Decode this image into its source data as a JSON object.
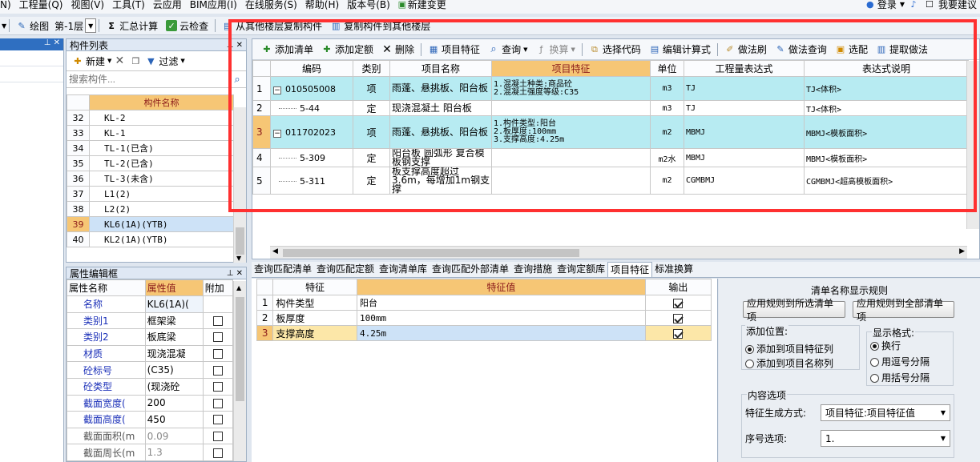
{
  "menubar": {
    "items": [
      "N)",
      "工程量(Q)",
      "视图(V)",
      "工具(T)",
      "云应用",
      "BIM应用(I)",
      "在线服务(S)",
      "帮助(H)",
      "版本号(B)",
      "新建变更"
    ],
    "login": "登录",
    "suggest": "我要建议"
  },
  "toolbar2": {
    "draw": "绘图",
    "floor": "第-1层",
    "sum": "汇总计算",
    "check": "云检查",
    "copy_from": "从其他楼层复制构件",
    "copy_to": "复制构件到其他楼层"
  },
  "component_list": {
    "title": "构件列表",
    "new_label": "新建",
    "filter_label": "过滤",
    "search_placeholder": "搜索构件...",
    "col_header": "构件名称",
    "rows": [
      {
        "n": "32",
        "name": "KL-2"
      },
      {
        "n": "33",
        "name": "KL-1"
      },
      {
        "n": "34",
        "name": "TL-1(已含)"
      },
      {
        "n": "35",
        "name": "TL-2(已含)"
      },
      {
        "n": "36",
        "name": "TL-3(未含)"
      },
      {
        "n": "37",
        "name": "L1(2)"
      },
      {
        "n": "38",
        "name": "L2(2)"
      },
      {
        "n": "39",
        "name": "KL6(1A)(YTB)"
      },
      {
        "n": "40",
        "name": "KL2(1A)(YTB)"
      }
    ],
    "selected_row": "39"
  },
  "property_editor": {
    "title": "属性编辑框",
    "cols": [
      "属性名称",
      "属性值",
      "附加"
    ],
    "rows": [
      {
        "name": "名称",
        "value": "KL6(1A)(",
        "extra": false
      },
      {
        "name": "类别1",
        "value": "框架梁",
        "extra": true
      },
      {
        "name": "类别2",
        "value": "板底梁",
        "extra": true
      },
      {
        "name": "材质",
        "value": "现浇混凝",
        "extra": true
      },
      {
        "name": "砼标号",
        "value": "(C35)",
        "extra": true
      },
      {
        "name": "砼类型",
        "value": "(现浇砼",
        "extra": true
      },
      {
        "name": "截面宽度(",
        "value": "200",
        "extra": true
      },
      {
        "name": "截面高度(",
        "value": "450",
        "extra": true
      },
      {
        "name": "截面面积(m",
        "value": "0.09",
        "extra": true
      },
      {
        "name": "截面周长(m",
        "value": "1.3",
        "extra": true
      }
    ]
  },
  "list_toolbar": {
    "add_list": "添加清单",
    "add_quota": "添加定额",
    "delete": "删除",
    "item_feature": "项目特征",
    "query": "查询",
    "convert": "换算",
    "select_code": "选择代码",
    "edit_formula": "编辑计算式",
    "method_brush": "做法刷",
    "method_query": "做法查询",
    "pick": "选配",
    "extract": "提取做法"
  },
  "bill_table": {
    "cols": [
      "编码",
      "类别",
      "项目名称",
      "项目特征",
      "单位",
      "工程量表达式",
      "表达式说明"
    ],
    "rows": [
      {
        "n": "1",
        "code": "010505008",
        "type": "项",
        "name": "雨蓬、悬挑板、阳台板",
        "feature": [
          "1.混凝土种类:商品砼",
          "2.混凝土强度等级:C35"
        ],
        "unit": "m3",
        "expr": "TJ",
        "desc": "TJ<体积>",
        "level": "parent"
      },
      {
        "n": "2",
        "code": "5-44",
        "type": "定",
        "name": "现浇混凝土 阳台板",
        "feature": [],
        "unit": "m3",
        "expr": "TJ",
        "desc": "TJ<体积>",
        "level": "child"
      },
      {
        "n": "3",
        "code": "011702023",
        "type": "项",
        "name": "雨蓬、悬挑板、阳台板",
        "feature": [
          "1.构件类型:阳台",
          "2.板厚度:100mm",
          "3.支撑高度:4.25m"
        ],
        "unit": "m2",
        "expr": "MBMJ",
        "desc": "MBMJ<模板面积>",
        "level": "parent"
      },
      {
        "n": "4",
        "code": "5-309",
        "type": "定",
        "name": "阳台板 圆弧形 复合模板钢支撑",
        "feature": [],
        "unit": "m2水",
        "expr": "MBMJ",
        "desc": "MBMJ<模板面积>",
        "level": "child"
      },
      {
        "n": "5",
        "code": "5-311",
        "type": "定",
        "name": "板支撑高度超过3.6m，每增加1m钢支撑",
        "feature": [],
        "unit": "m2",
        "expr": "CGMBMJ",
        "desc": "CGMBMJ<超高模板面积>",
        "level": "child"
      }
    ]
  },
  "bottom_tabs": [
    "查询匹配清单",
    "查询匹配定额",
    "查询清单库",
    "查询匹配外部清单",
    "查询措施",
    "查询定额库",
    "项目特征",
    "标准换算"
  ],
  "active_tab": "项目特征",
  "feature_table": {
    "cols": [
      "特征",
      "特征值",
      "输出"
    ],
    "rows": [
      {
        "n": "1",
        "feature": "构件类型",
        "value": "阳台",
        "output": true
      },
      {
        "n": "2",
        "feature": "板厚度",
        "value": "100mm",
        "output": true
      },
      {
        "n": "3",
        "feature": "支撑高度",
        "value": "4.25m",
        "output": true
      }
    ]
  },
  "rules": {
    "title": "清单名称显示规则",
    "apply_selected": "应用规则到所选清单项",
    "apply_all": "应用规则到全部清单项",
    "add_position": "添加位置:",
    "pos_feature": "添加到项目特征列",
    "pos_name": "添加到项目名称列",
    "display_format": "显示格式:",
    "fmt_newline": "换行",
    "fmt_comma": "用逗号分隔",
    "fmt_bracket": "用括号分隔",
    "content_options": "内容选项",
    "feature_gen_label": "特征生成方式:",
    "feature_gen_value": "项目特征:项目特征值",
    "serial_label": "序号选项:",
    "serial_value": "1."
  },
  "colors": {
    "highlight_row": "#b7ebf2",
    "header_orange": "#f6c675",
    "selection_row": "#fce7a8",
    "red_frame": "#ff3030"
  }
}
